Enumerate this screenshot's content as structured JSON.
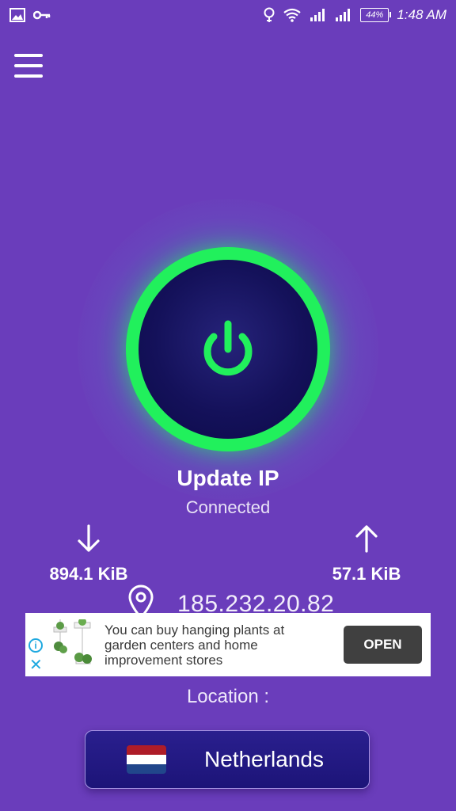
{
  "status_bar": {
    "time": "1:48 AM",
    "battery": "44%",
    "icons": [
      "image-icon",
      "key-icon",
      "bulb-icon",
      "wifi-icon",
      "signal-icon",
      "signal-icon-2",
      "battery-icon"
    ]
  },
  "menu": {
    "icon": "hamburger-menu-icon"
  },
  "power": {
    "icon": "power-icon",
    "ring_color": "#21f05c",
    "inner_color": "#14115a"
  },
  "status": {
    "title": "Update IP",
    "subtitle": "Connected"
  },
  "traffic": {
    "download": {
      "icon": "arrow-down-icon",
      "value": "894.1 KiB"
    },
    "upload": {
      "icon": "arrow-up-icon",
      "value": "57.1 KiB"
    }
  },
  "ip": {
    "icon": "location-pin-icon",
    "address": "185.232.20.82"
  },
  "ad": {
    "text": "You can buy hanging plants at garden centers and home improvement stores",
    "button": "OPEN",
    "info_icon": "info-icon",
    "close_icon": "close-icon"
  },
  "location": {
    "label": "Location :",
    "country": "Netherlands",
    "flag_colors": [
      "#ae1c28",
      "#ffffff",
      "#21468b"
    ]
  },
  "colors": {
    "background": "#6a3dbb",
    "accent": "#21f05c"
  }
}
